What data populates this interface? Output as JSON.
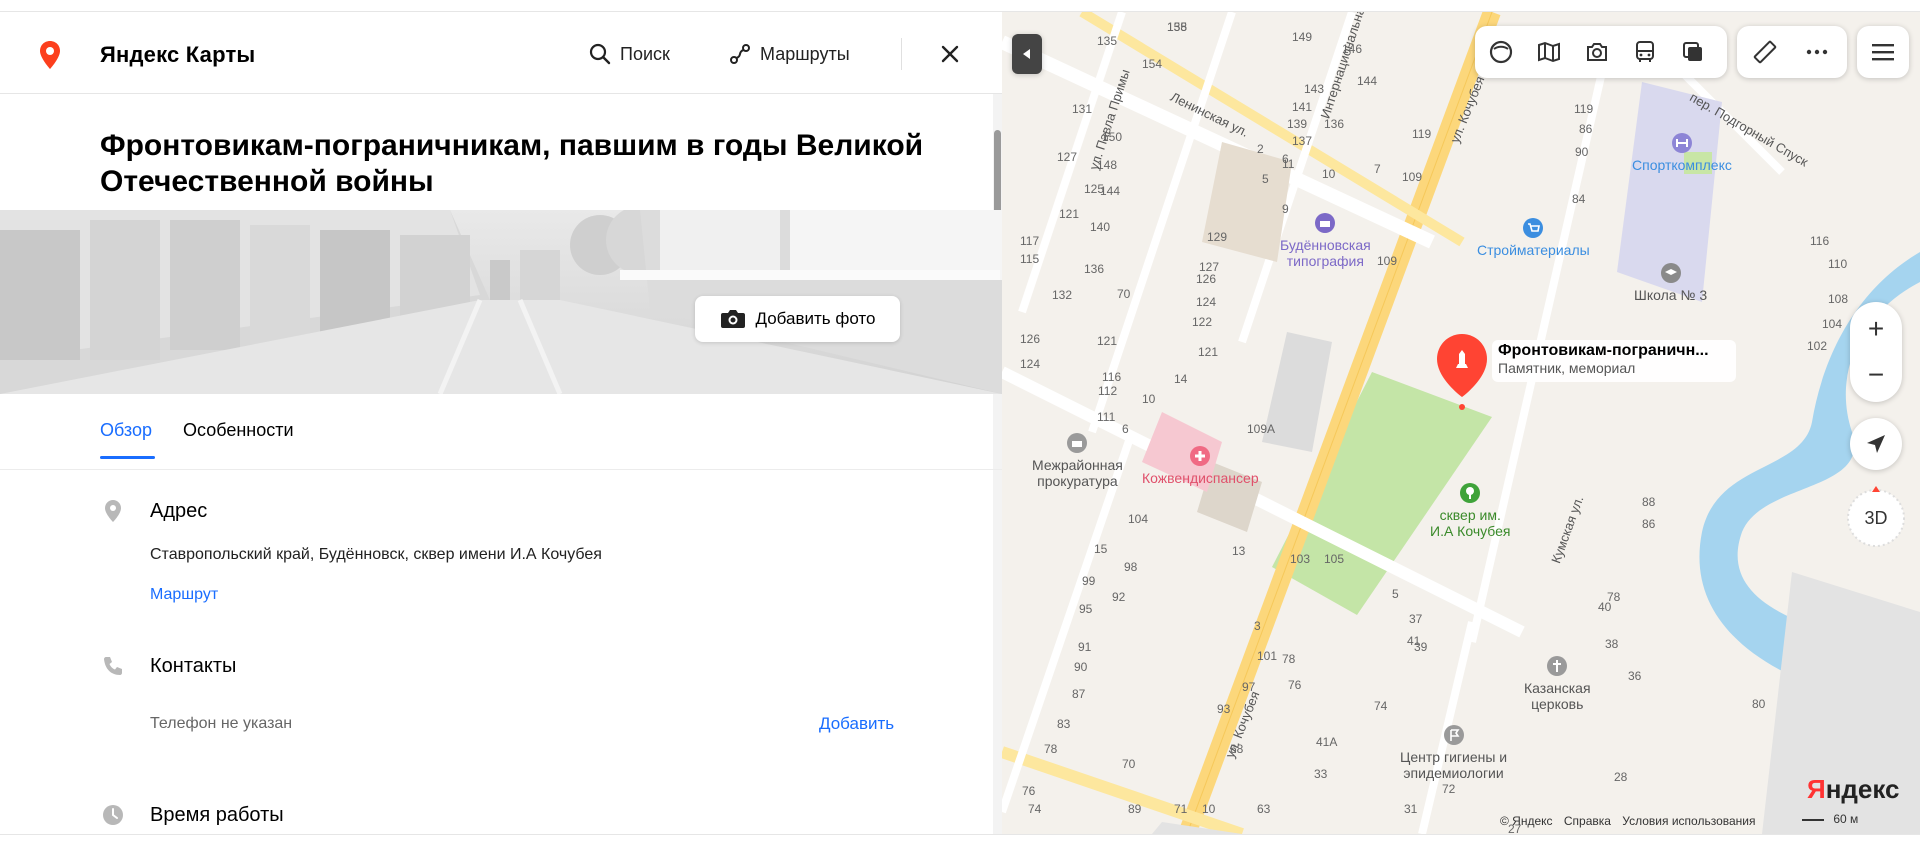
{
  "header": {
    "brand": "Яндекс Карты",
    "search_label": "Поиск",
    "routes_label": "Маршруты"
  },
  "place": {
    "title": "Фронтовикам-пограничникам, павшим в годы Великой Отечественной войны",
    "add_photo_label": "Добавить фото"
  },
  "tabs": [
    {
      "label": "Обзор",
      "active": true
    },
    {
      "label": "Особенности",
      "active": false
    }
  ],
  "address": {
    "title": "Адрес",
    "text": "Ставропольский край, Будённовск, сквер имени И.А Кочубея",
    "route_link": "Маршрут"
  },
  "contacts": {
    "title": "Контакты",
    "phone_text": "Телефон не указан",
    "add_link": "Добавить"
  },
  "hours": {
    "title": "Время работы"
  },
  "map": {
    "selected_poi": {
      "name": "Фронтовикам-пограничн...",
      "category": "Памятник, мемориал"
    },
    "zoom_in": "+",
    "zoom_out": "−",
    "mode_3d": "3D",
    "pois": [
      {
        "label": "Будённовская\nтипография",
        "color": "#7c69c7"
      },
      {
        "label": "Стройматериалы",
        "color": "#3b8ee0"
      },
      {
        "label": "Спорткомплекс",
        "color": "#3b8ee0"
      },
      {
        "label": "Школа № 3",
        "color": "#666666"
      },
      {
        "label": "Межрайонная\nпрокуратура",
        "color": "#555555"
      },
      {
        "label": "Кожвендиспансер",
        "color": "#e0506b"
      },
      {
        "label": "сквер им.\nИ.А Кочубея",
        "color": "#3a8a2a"
      },
      {
        "label": "Казанская\nцерковь",
        "color": "#555555"
      },
      {
        "label": "Центр гигиены и\nэпидемиологии",
        "color": "#555555"
      }
    ],
    "streets": [
      "Ленинская ул.",
      "ул. Павла Примы",
      "Интернациональная",
      "ул. Кочубея",
      "ул. Кочубея",
      "пер. Подгорный Спуск",
      "Кумская ул."
    ],
    "building_numbers": [
      "158",
      "135",
      "154",
      "149",
      "146",
      "144",
      "143",
      "141",
      "139",
      "137",
      "136",
      "131",
      "127",
      "125",
      "121",
      "117",
      "115",
      "150",
      "148",
      "144",
      "140",
      "136",
      "132",
      "126",
      "124",
      "119",
      "119",
      "86",
      "90",
      "84",
      "70",
      "121",
      "116",
      "112",
      "111",
      "109",
      "14",
      "10",
      "6",
      "109",
      "129",
      "127",
      "126",
      "124",
      "122",
      "121",
      "15",
      "13",
      "104",
      "98",
      "99",
      "95",
      "92",
      "91",
      "90",
      "87",
      "83",
      "78",
      "76",
      "74",
      "70",
      "93",
      "97",
      "101",
      "103",
      "105",
      "5",
      "3",
      "78",
      "76",
      "74",
      "37",
      "41",
      "39",
      "41А",
      "33",
      "31",
      "27",
      "72",
      "40",
      "38",
      "36",
      "28",
      "80",
      "88",
      "86",
      "78",
      "116",
      "110",
      "108",
      "104",
      "102",
      "109А",
      "89",
      "71",
      "68",
      "63",
      "10",
      "2",
      "6",
      "10",
      "7",
      "5",
      "11",
      "9",
      "135"
    ],
    "footer": {
      "copyright": "© Яндекс",
      "help": "Справка",
      "terms": "Условия использования",
      "scale": "60 м",
      "logo": "Яндекс"
    }
  }
}
